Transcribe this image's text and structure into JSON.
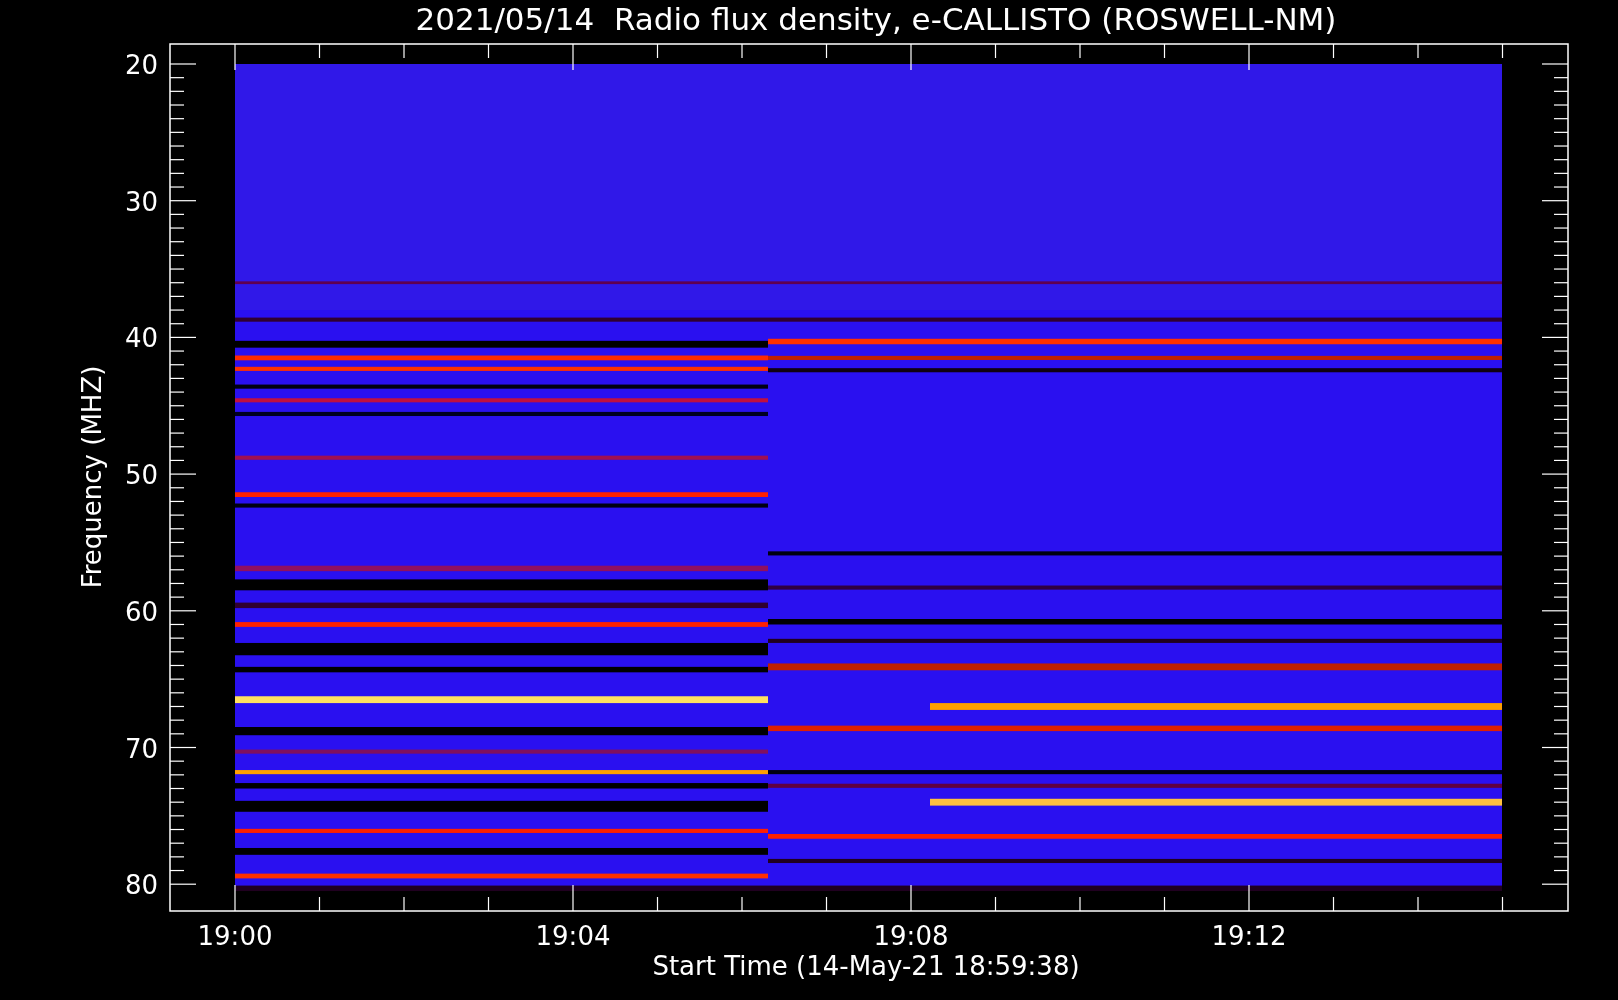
{
  "title": "2021/05/14  Radio flux density, e-CALLISTO (ROSWELL-NM)",
  "y_axis": {
    "label": "Frequency (MHZ)",
    "ticks": [
      "20",
      "30",
      "40",
      "50",
      "60",
      "70",
      "80"
    ]
  },
  "x_axis": {
    "label": "Start Time (14-May-21 18:59:38)",
    "ticks": [
      "19:00",
      "19:04",
      "19:08",
      "19:12"
    ]
  }
}
